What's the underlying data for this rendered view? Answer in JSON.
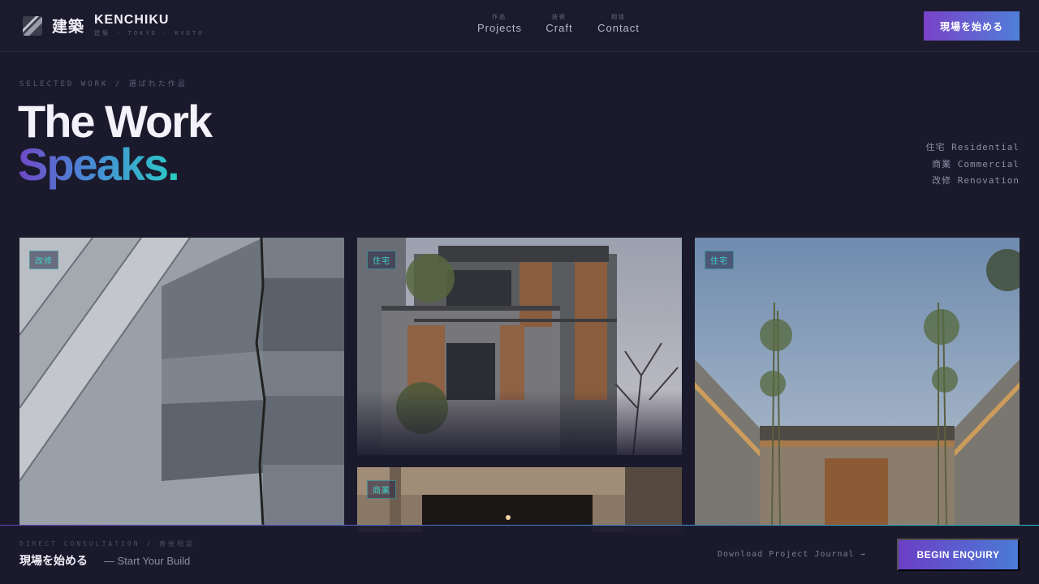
{
  "brand": {
    "kanji": "建築",
    "name": "KENCHIKU",
    "subtitle": "建築 · TOKYO · KYOTO",
    "logo_icon": "diagonal-slash-logo"
  },
  "nav": {
    "items": [
      {
        "jp": "作品",
        "label": "Projects"
      },
      {
        "jp": "技術",
        "label": "Craft"
      },
      {
        "jp": "相談",
        "label": "Contact"
      }
    ],
    "cta_label": "現場を始める"
  },
  "hero": {
    "eyebrow": "SELECTED WORK / 選ばれた作品",
    "title_line1": "The Work",
    "title_line2": "Speaks",
    "title_dot": "."
  },
  "categories": [
    "住宅 Residential",
    "商業 Commercial",
    "改修 Renovation"
  ],
  "gallery": {
    "cards": [
      {
        "tag": "改修",
        "image": "folded-concrete-facade"
      },
      {
        "tag": "住宅",
        "image": "timber-louvered-townhouse"
      },
      {
        "tag": "商業",
        "image": "concrete-canopy-interior"
      },
      {
        "tag": "住宅",
        "image": "bamboo-courtyard-house"
      }
    ]
  },
  "footer": {
    "eyebrow": "DIRECT CONSULTATION / 直接相談",
    "title": "現場を始める",
    "subtitle": "— Start Your Build",
    "download_label": "Download Project Journal →",
    "button_label": "BEGIN ENQUIRY"
  },
  "colors": {
    "background": "#1b1a2d",
    "accent_purple": "#7a42c8",
    "accent_blue": "#4f7fd8",
    "accent_teal": "#2ec4c8"
  }
}
